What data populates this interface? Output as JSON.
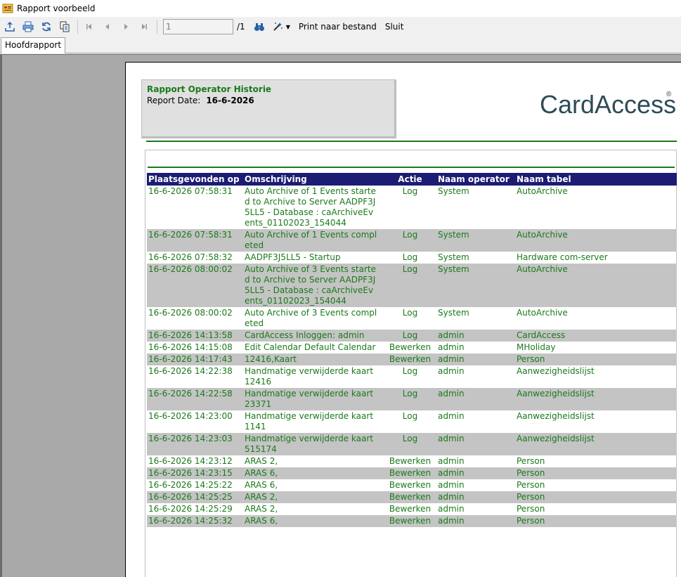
{
  "window": {
    "title": "Rapport voorbeeld"
  },
  "toolbar": {
    "page_value": "1",
    "page_total": "/1",
    "print_to_file": "Print naar bestand",
    "close": "Sluit"
  },
  "tabs": [
    {
      "label": "Hoofdrapport"
    }
  ],
  "report": {
    "title": "Rapport Operator Historie",
    "date_label": "Report Date:",
    "date_value": "16-6-2026",
    "logo_text": "CardAccess",
    "columns": [
      "Plaatsgevonden op",
      "Omschrijving",
      "Actie",
      "Naam operator",
      "Naam tabel"
    ],
    "rows": [
      {
        "date": "16-6-2026 07:58:31",
        "desc": "Auto Archive of 1 Events started to Archive to Server AADPF3J5LL5 - Database : caArchiveEvents_01102023_154044",
        "action": "Log",
        "operator": "System",
        "table": "AutoArchive"
      },
      {
        "date": "16-6-2026 07:58:31",
        "desc": "Auto Archive of 1 Events completed",
        "action": "Log",
        "operator": "System",
        "table": "AutoArchive"
      },
      {
        "date": "16-6-2026 07:58:32",
        "desc": "AADPF3J5LL5 - Startup",
        "action": "Log",
        "operator": "System",
        "table": "Hardware com-server"
      },
      {
        "date": "16-6-2026 08:00:02",
        "desc": "Auto Archive of 3 Events started to Archive to Server AADPF3J5LL5 - Database : caArchiveEvents_01102023_154044",
        "action": "Log",
        "operator": "System",
        "table": "AutoArchive"
      },
      {
        "date": "16-6-2026 08:00:02",
        "desc": "Auto Archive of 3 Events completed",
        "action": "Log",
        "operator": "System",
        "table": "AutoArchive"
      },
      {
        "date": "16-6-2026 14:13:58",
        "desc": "CardAccess Inloggen: admin",
        "action": "Log",
        "operator": "admin",
        "table": "CardAccess"
      },
      {
        "date": "16-6-2026 14:15:08",
        "desc": "Edit Calendar Default Calendar",
        "action": "Bewerken",
        "operator": "admin",
        "table": "MHoliday"
      },
      {
        "date": "16-6-2026 14:17:43",
        "desc": "12416,Kaart",
        "action": "Bewerken",
        "operator": "admin",
        "table": "Person"
      },
      {
        "date": "16-6-2026 14:22:38",
        "desc": "Handmatige verwijderde kaart 12416",
        "action": "Log",
        "operator": "admin",
        "table": "Aanwezigheidslijst"
      },
      {
        "date": "16-6-2026 14:22:58",
        "desc": "Handmatige verwijderde kaart 23371",
        "action": "Log",
        "operator": "admin",
        "table": "Aanwezigheidslijst"
      },
      {
        "date": "16-6-2026 14:23:00",
        "desc": "Handmatige verwijderde kaart 1141",
        "action": "Log",
        "operator": "admin",
        "table": "Aanwezigheidslijst"
      },
      {
        "date": "16-6-2026 14:23:03",
        "desc": "Handmatige verwijderde kaart 515174",
        "action": "Log",
        "operator": "admin",
        "table": "Aanwezigheidslijst"
      },
      {
        "date": "16-6-2026 14:23:12",
        "desc": "ARAS 2,",
        "action": "Bewerken",
        "operator": "admin",
        "table": "Person"
      },
      {
        "date": "16-6-2026 14:23:15",
        "desc": "ARAS 6,",
        "action": "Bewerken",
        "operator": "admin",
        "table": "Person"
      },
      {
        "date": "16-6-2026 14:25:22",
        "desc": "ARAS 6,",
        "action": "Bewerken",
        "operator": "admin",
        "table": "Person"
      },
      {
        "date": "16-6-2026 14:25:25",
        "desc": "ARAS 2,",
        "action": "Bewerken",
        "operator": "admin",
        "table": "Person"
      },
      {
        "date": "16-6-2026 14:25:29",
        "desc": "ARAS 2,",
        "action": "Bewerken",
        "operator": "admin",
        "table": "Person"
      },
      {
        "date": "16-6-2026 14:25:32",
        "desc": "ARAS 6,",
        "action": "Bewerken",
        "operator": "admin",
        "table": "Person"
      }
    ]
  }
}
